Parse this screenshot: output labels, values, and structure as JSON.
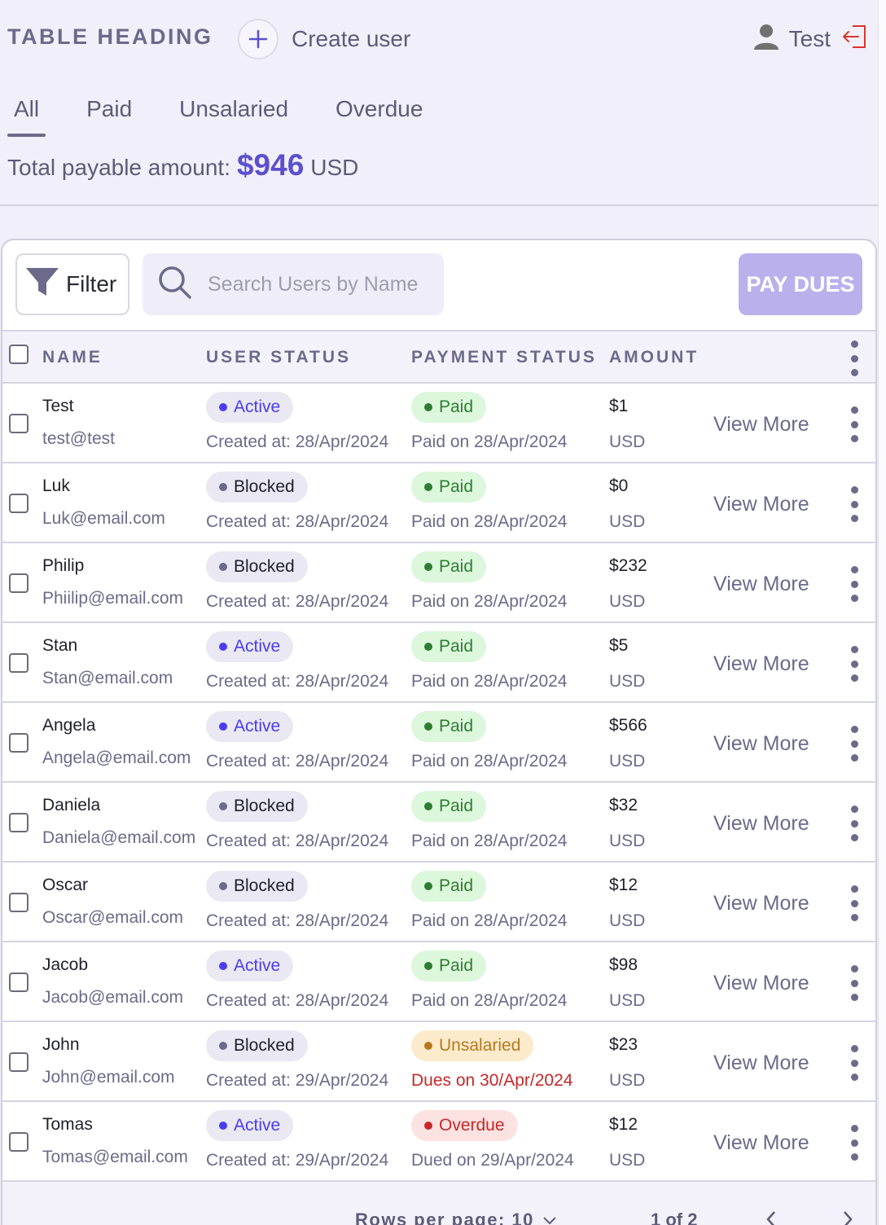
{
  "header": {
    "title": "TABLE HEADING",
    "create_label": "Create user",
    "user_name": "Test"
  },
  "tabs": [
    {
      "label": "All",
      "active": true
    },
    {
      "label": "Paid",
      "active": false
    },
    {
      "label": "Unsalaried",
      "active": false
    },
    {
      "label": "Overdue",
      "active": false
    }
  ],
  "summary": {
    "label": "Total payable amount:",
    "amount": "$946",
    "currency": "USD"
  },
  "toolbar": {
    "filter_label": "Filter",
    "search_placeholder": "Search Users by Name",
    "search_value": "",
    "pay_label": "PAY DUES"
  },
  "columns": [
    "NAME",
    "USER STATUS",
    "PAYMENT STATUS",
    "AMOUNT"
  ],
  "rows": [
    {
      "name": "Test",
      "email": "test@test",
      "user_status": "Active",
      "created": "Created at: 28/Apr/2024",
      "payment_status": "Paid",
      "payment_note": "Paid on 28/Apr/2024",
      "amount": "$1",
      "currency": "USD",
      "action": "View More"
    },
    {
      "name": "Luk",
      "email": "Luk@email.com",
      "user_status": "Blocked",
      "created": "Created at: 28/Apr/2024",
      "payment_status": "Paid",
      "payment_note": "Paid on 28/Apr/2024",
      "amount": "$0",
      "currency": "USD",
      "action": "View More"
    },
    {
      "name": "Philip",
      "email": "Phiilip@email.com",
      "user_status": "Blocked",
      "created": "Created at: 28/Apr/2024",
      "payment_status": "Paid",
      "payment_note": "Paid on 28/Apr/2024",
      "amount": "$232",
      "currency": "USD",
      "action": "View More"
    },
    {
      "name": "Stan",
      "email": "Stan@email.com",
      "user_status": "Active",
      "created": "Created at: 28/Apr/2024",
      "payment_status": "Paid",
      "payment_note": "Paid on 28/Apr/2024",
      "amount": "$5",
      "currency": "USD",
      "action": "View More"
    },
    {
      "name": "Angela",
      "email": "Angela@email.com",
      "user_status": "Active",
      "created": "Created at: 28/Apr/2024",
      "payment_status": "Paid",
      "payment_note": "Paid on 28/Apr/2024",
      "amount": "$566",
      "currency": "USD",
      "action": "View More"
    },
    {
      "name": "Daniela",
      "email": "Daniela@email.com",
      "user_status": "Blocked",
      "created": "Created at: 28/Apr/2024",
      "payment_status": "Paid",
      "payment_note": "Paid on 28/Apr/2024",
      "amount": "$32",
      "currency": "USD",
      "action": "View More"
    },
    {
      "name": "Oscar",
      "email": "Oscar@email.com",
      "user_status": "Blocked",
      "created": "Created at: 28/Apr/2024",
      "payment_status": "Paid",
      "payment_note": "Paid on 28/Apr/2024",
      "amount": "$12",
      "currency": "USD",
      "action": "View More"
    },
    {
      "name": "Jacob",
      "email": "Jacob@email.com",
      "user_status": "Active",
      "created": "Created at: 28/Apr/2024",
      "payment_status": "Paid",
      "payment_note": "Paid on 28/Apr/2024",
      "amount": "$98",
      "currency": "USD",
      "action": "View More"
    },
    {
      "name": "John",
      "email": "John@email.com",
      "user_status": "Blocked",
      "created": "Created at: 29/Apr/2024",
      "payment_status": "Unsalaried",
      "payment_note": "Dues on 30/Apr/2024",
      "amount": "$23",
      "currency": "USD",
      "action": "View More"
    },
    {
      "name": "Tomas",
      "email": "Tomas@email.com",
      "user_status": "Active",
      "created": "Created at: 29/Apr/2024",
      "payment_status": "Overdue",
      "payment_note": "Dued on 29/Apr/2024",
      "amount": "$12",
      "currency": "USD",
      "action": "View More"
    }
  ],
  "pagination": {
    "rows_per_page_label": "Rows per page: 10",
    "page_info": "1 of 2"
  },
  "colors": {
    "accent": "#5c4fcf",
    "active_dot": "#4a3df0",
    "blocked_dot": "#6c6a8a",
    "paid_bg": "#dcf7dc",
    "paid_fg": "#2e7d32",
    "unsalaried_bg": "#fcebcb",
    "unsalaried_fg": "#b7791f",
    "overdue_bg": "#fde2e2",
    "overdue_fg": "#c62828"
  },
  "icons": {
    "create": "plus-icon",
    "user": "user-icon",
    "logout": "logout-icon",
    "filter": "filter-icon",
    "search": "search-icon",
    "more": "kebab-icon",
    "dropdown": "chevron-down-icon",
    "prev": "chevron-left-icon",
    "next": "chevron-right-icon"
  }
}
